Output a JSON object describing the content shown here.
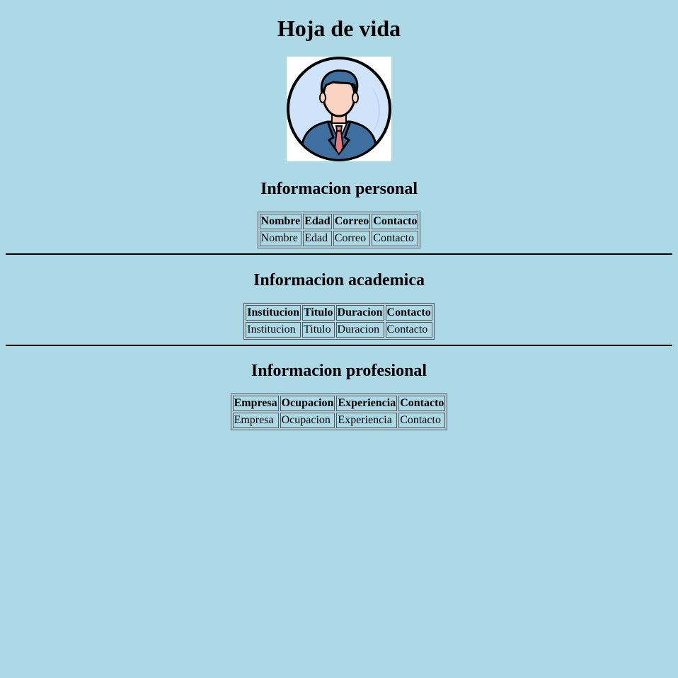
{
  "page": {
    "title": "Hoja de vida",
    "background_color": "#add8e6"
  },
  "avatar": {
    "icon": "businessman-avatar-icon"
  },
  "sections": [
    {
      "heading": "Informacion personal",
      "headers": [
        "Nombre",
        "Edad",
        "Correo",
        "Contacto"
      ],
      "row": [
        "Nombre",
        "Edad",
        "Correo",
        "Contacto"
      ]
    },
    {
      "heading": "Informacion academica",
      "headers": [
        "Institucion",
        "Titulo",
        "Duracion",
        "Contacto"
      ],
      "row": [
        "Institucion",
        "Titulo",
        "Duracion",
        "Contacto"
      ]
    },
    {
      "heading": "Informacion profesional",
      "headers": [
        "Empresa",
        "Ocupacion",
        "Experiencia",
        "Contacto"
      ],
      "row": [
        "Empresa",
        "Ocupacion",
        "Experiencia",
        "Contacto"
      ]
    }
  ]
}
